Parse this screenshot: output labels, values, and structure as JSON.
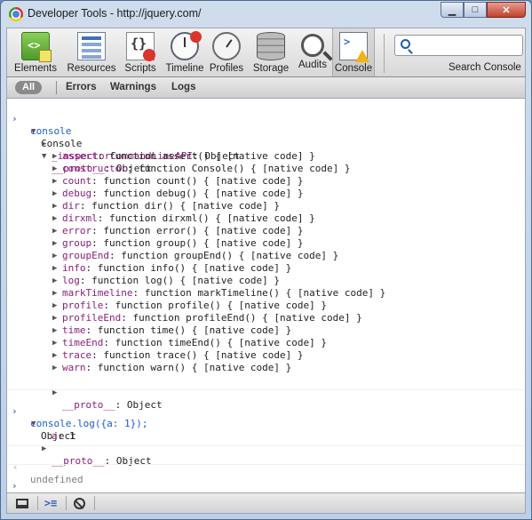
{
  "window": {
    "title": "Developer Tools - http://jquery.com/"
  },
  "toolbar": {
    "tools": [
      {
        "label": "Elements",
        "icon": "elements-icon"
      },
      {
        "label": "Resources",
        "icon": "resources-icon"
      },
      {
        "label": "Scripts",
        "icon": "scripts-icon"
      },
      {
        "label": "Timeline",
        "icon": "timeline-icon"
      },
      {
        "label": "Profiles",
        "icon": "profiles-icon"
      },
      {
        "label": "Storage",
        "icon": "storage-icon"
      },
      {
        "label": "Audits",
        "icon": "audits-icon"
      },
      {
        "label": "Console",
        "icon": "console-icon",
        "active": true
      }
    ],
    "search_label": "Search Console",
    "search_value": ""
  },
  "filters": {
    "all": "All",
    "errors": "Errors",
    "warnings": "Warnings",
    "logs": "Logs"
  },
  "console": {
    "entry1": {
      "command": "console",
      "root_label": "Console",
      "inspector_key": "_inspectorCommandLineAPI",
      "inspector_value": "Object",
      "proto_key": "__proto__",
      "proto_value": "Object",
      "methods": [
        {
          "key": "assert",
          "value": "function assert() { [native code] }"
        },
        {
          "key": "constructor",
          "value": "function Console() { [native code] }"
        },
        {
          "key": "count",
          "value": "function count() { [native code] }"
        },
        {
          "key": "debug",
          "value": "function debug() { [native code] }"
        },
        {
          "key": "dir",
          "value": "function dir() { [native code] }"
        },
        {
          "key": "dirxml",
          "value": "function dirxml() { [native code] }"
        },
        {
          "key": "error",
          "value": "function error() { [native code] }"
        },
        {
          "key": "group",
          "value": "function group() { [native code] }"
        },
        {
          "key": "groupEnd",
          "value": "function groupEnd() { [native code] }"
        },
        {
          "key": "info",
          "value": "function info() { [native code] }"
        },
        {
          "key": "log",
          "value": "function log() { [native code] }"
        },
        {
          "key": "markTimeline",
          "value": "function markTimeline() { [native code] }"
        },
        {
          "key": "profile",
          "value": "function profile() { [native code] }"
        },
        {
          "key": "profileEnd",
          "value": "function profileEnd() { [native code] }"
        },
        {
          "key": "time",
          "value": "function time() { [native code] }"
        },
        {
          "key": "timeEnd",
          "value": "function timeEnd() { [native code] }"
        },
        {
          "key": "trace",
          "value": "function trace() { [native code] }"
        },
        {
          "key": "warn",
          "value": "function warn() { [native code] }"
        }
      ],
      "inner_proto_key": "__proto__",
      "inner_proto_value": "Object"
    },
    "entry2": {
      "command": "console.log({a: 1});",
      "root_label": "Object",
      "prop_key": "a",
      "prop_value": "1",
      "proto_key": "__proto__",
      "proto_value": "Object"
    },
    "result": "undefined",
    "input_value": ""
  },
  "statusbar": {
    "dock_icon": "dock-icon",
    "console_icon": "console-toggle-icon",
    "clear_icon": "clear-icon"
  }
}
